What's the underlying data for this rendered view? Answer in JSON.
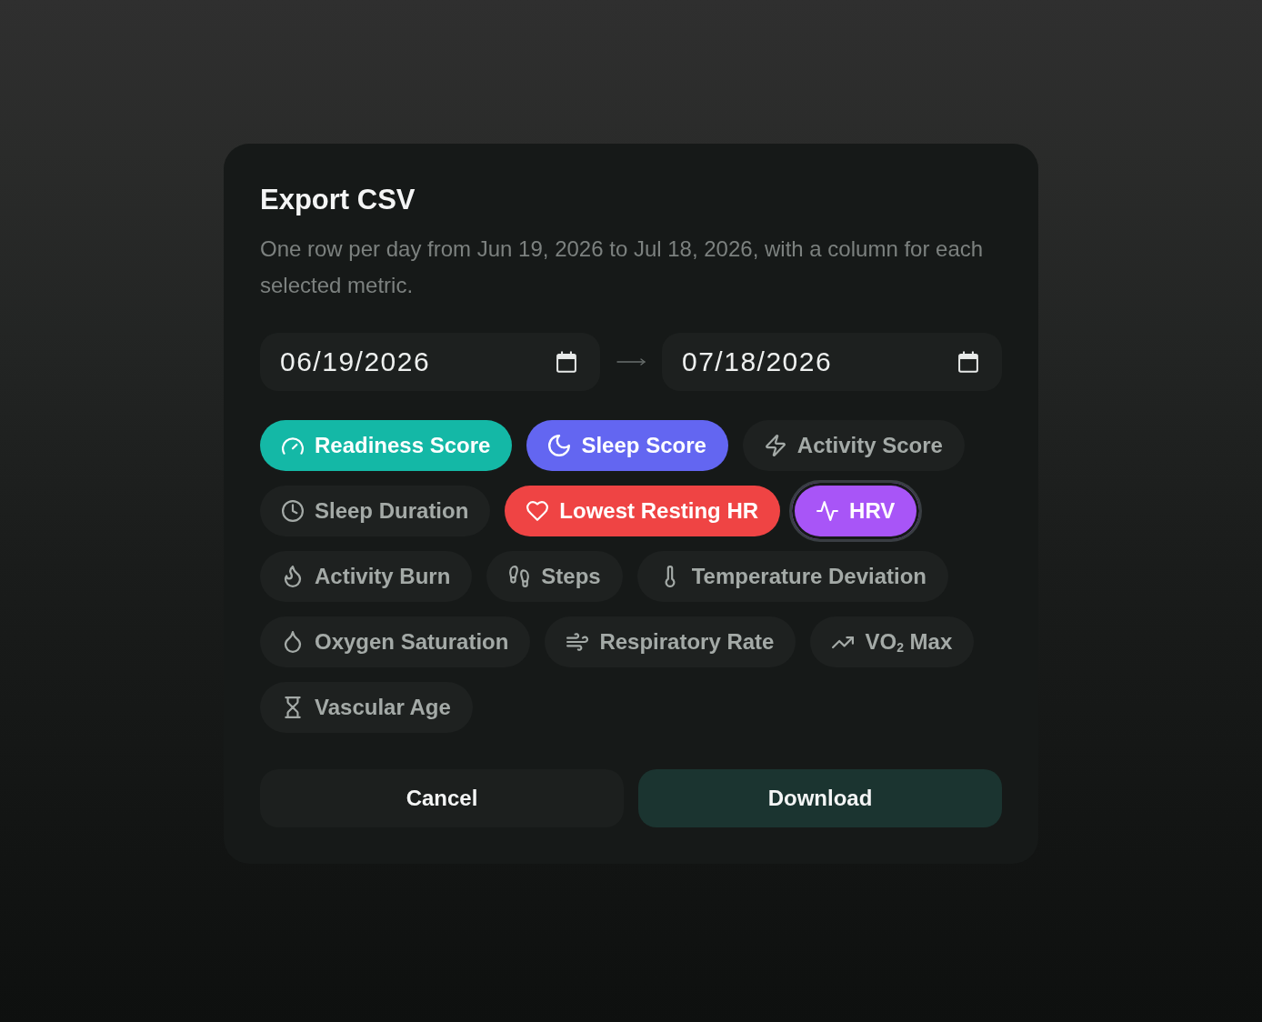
{
  "dialog": {
    "title": "Export CSV",
    "description": "One row per day from Jun 19, 2026 to Jul 18, 2026, with a column for each selected metric.",
    "date_range": {
      "start": "06/19/2026",
      "end": "07/18/2026"
    },
    "metrics": [
      {
        "label": "Readiness Score",
        "selected": true,
        "focused": false,
        "color": "#14b8a6"
      },
      {
        "label": "Sleep Score",
        "selected": true,
        "focused": false,
        "color": "#6366f1"
      },
      {
        "label": "Activity Score",
        "selected": false,
        "focused": false
      },
      {
        "label": "Sleep Duration",
        "selected": false,
        "focused": false
      },
      {
        "label": "Lowest Resting HR",
        "selected": true,
        "focused": false,
        "color": "#ef4444"
      },
      {
        "label": "HRV",
        "selected": true,
        "focused": true,
        "color": "#a855f7"
      },
      {
        "label": "Activity Burn",
        "selected": false,
        "focused": false
      },
      {
        "label": "Steps",
        "selected": false,
        "focused": false
      },
      {
        "label": "Temperature Deviation",
        "selected": false,
        "focused": false
      },
      {
        "label": "Oxygen Saturation",
        "selected": false,
        "focused": false
      },
      {
        "label": "Respiratory Rate",
        "selected": false,
        "focused": false
      },
      {
        "label": "VO$_{2}$ Max",
        "selected": false,
        "focused": false
      },
      {
        "label": "Vascular Age",
        "selected": false,
        "focused": false
      }
    ],
    "buttons": [
      {
        "label": "Cancel",
        "kind": "secondary"
      },
      {
        "label": "Download",
        "kind": "primary"
      }
    ]
  }
}
